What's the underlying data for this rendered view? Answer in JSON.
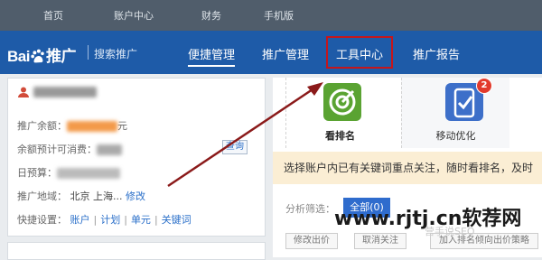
{
  "topbar": {
    "items": [
      "首页",
      "账户中心",
      "财务",
      "手机版"
    ]
  },
  "brand": {
    "logo_text": "Bai",
    "logo_du": "du",
    "logo_suffix": "推广",
    "subtitle": "搜索推广"
  },
  "nav": {
    "items": [
      "便捷管理",
      "推广管理",
      "工具中心",
      "推广报告"
    ],
    "active": "便捷管理",
    "highlighted": "工具中心"
  },
  "account_panel": {
    "balance_label": "推广余额：",
    "balance_suffix": "元",
    "days_label": "余额预计可消费：",
    "query_button": "查询",
    "budget_label": "日预算：",
    "region_label": "推广地域：",
    "region_value": "北京 上海...",
    "region_edit": "修改",
    "quick_label": "快捷设置：",
    "quick_links": [
      "账户",
      "计划",
      "单元",
      "关键词"
    ]
  },
  "tools": [
    {
      "label": "看排名",
      "icon": "target-icon",
      "color": "#5aa332"
    },
    {
      "label": "移动优化",
      "icon": "mobile-check-icon",
      "color": "#3d6fc9",
      "badge": "2"
    }
  ],
  "notice_text": "选择账户内已有关键词重点关注，随时看排名，及时",
  "filter": {
    "label": "分析筛选：",
    "all_button": "全部(0)"
  },
  "actions": [
    "修改出价",
    "取消关注",
    "加入排名倾向出价策略"
  ],
  "watermark": {
    "text": "www.rjtj.cn软荐网",
    "sub": "营手说SEO"
  },
  "colors": {
    "nav_bg": "#1e5ba8",
    "highlight_box": "#c4161c",
    "arrow": "#8b1a1a"
  }
}
